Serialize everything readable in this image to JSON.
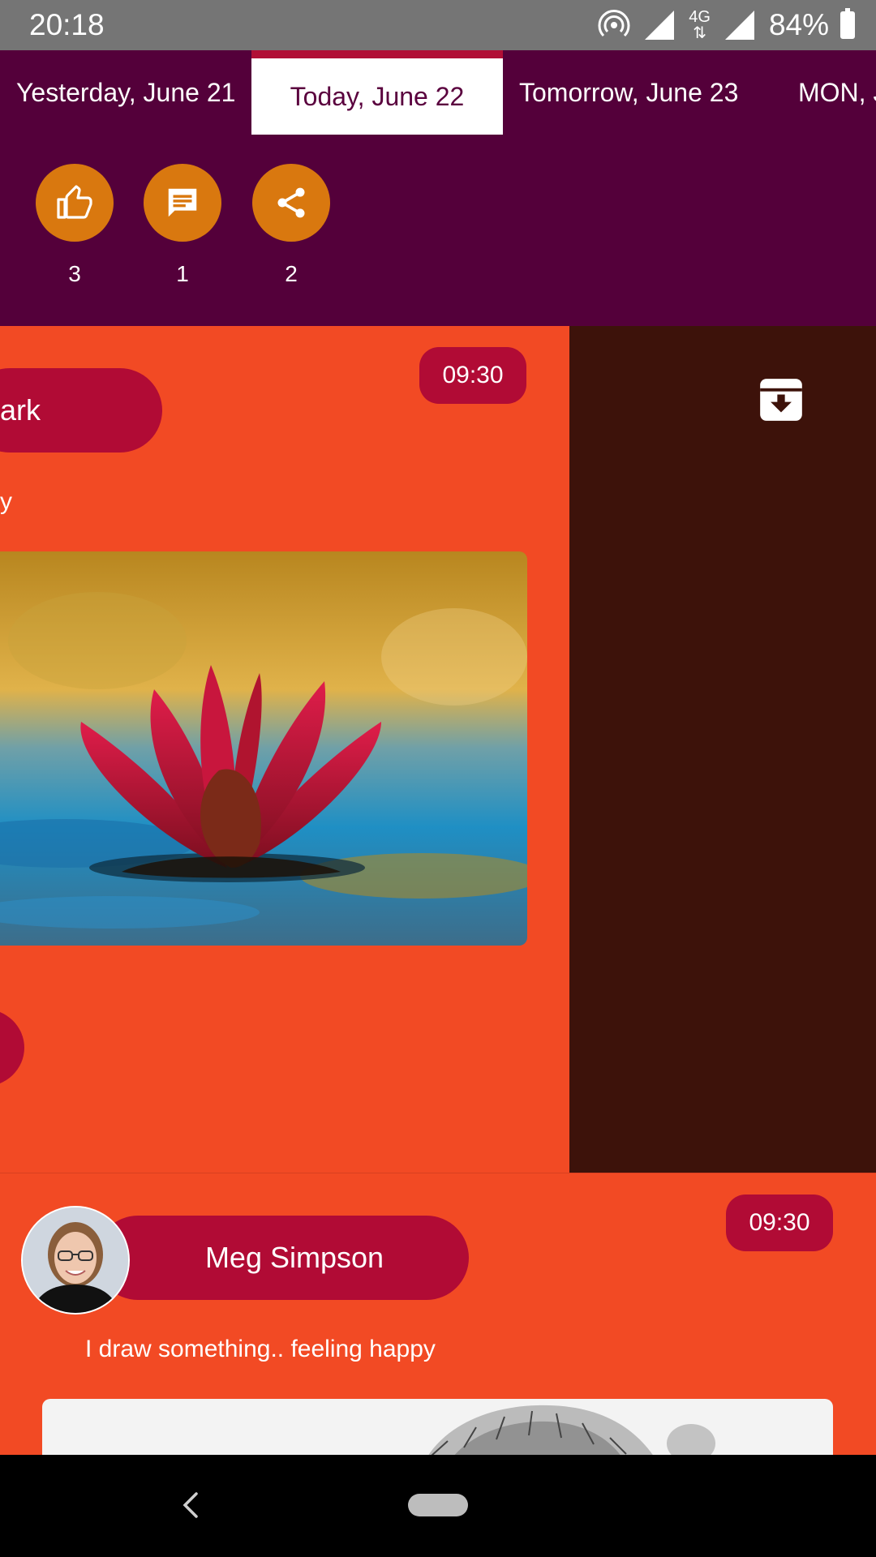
{
  "status": {
    "time": "20:18",
    "network": "4G",
    "battery": "84%"
  },
  "dates": {
    "yesterday": "Yesterday, June 21",
    "today": "Today, June 22",
    "tomorrow": "Tomorrow, June 23",
    "next": "MON, J"
  },
  "actions": {
    "likes": "3",
    "comments": "1",
    "shares": "2"
  },
  "post1": {
    "time": "09:30",
    "name_fragment": "ark",
    "caption_fragment": "y"
  },
  "post2": {
    "time": "09:30",
    "name": "Meg Simpson",
    "caption": "I draw something.. feeling happy"
  },
  "colors": {
    "header_bg": "#54003a",
    "accent": "#b10b35",
    "post_bg": "#f24a24",
    "action_orange": "#d9780f",
    "archive_bg": "#3d120a"
  },
  "icons": [
    "thumb-up-icon",
    "comment-icon",
    "share-icon",
    "archive-icon",
    "back-icon",
    "home-pill-icon"
  ]
}
